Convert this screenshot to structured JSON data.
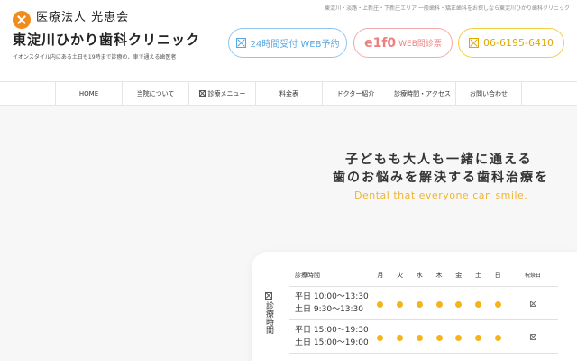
{
  "header": {
    "tagline": "東淀川・淡路・上新庄・下新庄エリア 一般歯科・矯正歯科をお探しなら東淀川ひかり歯科クリニック",
    "org": "医療法人 光恵会",
    "clinic_name": "東淀川ひかり歯科クリニック",
    "description": "イオンスタイル内にある土日も19時まで診療の、車で通える歯医者",
    "buttons": {
      "web": "24時間受付 WEB予約",
      "eparq_logo": "e1f0",
      "eparq_label": "WEB問診票",
      "tel": "06-6195-6410"
    }
  },
  "nav": [
    "HOME",
    "当院について",
    "診療メニュー",
    "料金表",
    "ドクター紹介",
    "診療時間・アクセス",
    "お問い合わせ"
  ],
  "hero": {
    "line1": "子どもも大人も一緒に通える",
    "line2": "歯のお悩みを解決する歯科治療を",
    "english": "Dental that everyone can smile."
  },
  "hours": {
    "side_label": "診療時間",
    "header": [
      "診療時間",
      "月",
      "火",
      "水",
      "木",
      "金",
      "土",
      "日",
      "祝祭日"
    ],
    "rows": [
      {
        "line1": "平日 10:00〜13:30",
        "line2": "土日 9:30〜13:30"
      },
      {
        "line1": "平日 15:00〜19:30",
        "line2": "土日 15:00〜19:00"
      }
    ]
  },
  "colors": {
    "accent_orange": "#f08c1e",
    "dot_yellow": "#f4b41a",
    "web_blue": "#5aa8e1",
    "eparq_pink": "#ee7f7f",
    "tel_yellow": "#e0a800"
  }
}
